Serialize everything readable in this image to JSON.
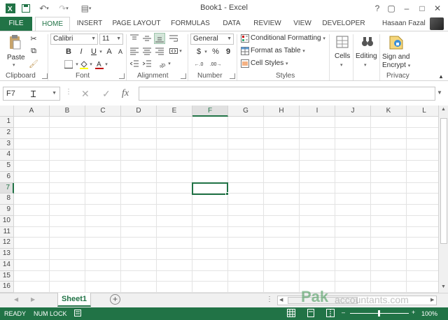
{
  "titlebar": {
    "title": "Book1 - Excel",
    "help": "?",
    "restore": "▢",
    "minimize": "–",
    "maximize": "□",
    "close": "✕"
  },
  "tabs": [
    "FILE",
    "HOME",
    "INSERT",
    "PAGE LAYOUT",
    "FORMULAS",
    "DATA",
    "REVIEW",
    "VIEW",
    "DEVELOPER"
  ],
  "user": "Hasaan Fazal",
  "ribbon": {
    "clipboard": {
      "paste": "Paste",
      "label": "Clipboard"
    },
    "font": {
      "family": "Calibri",
      "size": "11",
      "bold": "B",
      "italic": "I",
      "underline": "U",
      "grow": "A",
      "shrink": "A",
      "label": "Font"
    },
    "alignment": {
      "label": "Alignment"
    },
    "number": {
      "format": "General",
      "currency": "$",
      "percent": "%",
      "comma": "9",
      "label": "Number"
    },
    "styles": {
      "conditional": "Conditional Formatting",
      "table": "Format as Table",
      "cell": "Cell Styles",
      "label": "Styles"
    },
    "cells": {
      "label": "Cells"
    },
    "editing": {
      "label": "Editing"
    },
    "privacy": {
      "sign": "Sign and",
      "encrypt": "Encrypt",
      "label": "Privacy"
    }
  },
  "formula_bar": {
    "name_box": "F7",
    "fx": "fx",
    "cancel": "✕",
    "enter": "✓",
    "value": ""
  },
  "grid": {
    "columns": [
      "A",
      "B",
      "C",
      "D",
      "E",
      "F",
      "G",
      "H",
      "I",
      "J",
      "K",
      "L"
    ],
    "rows": [
      "1",
      "2",
      "3",
      "4",
      "5",
      "6",
      "7",
      "8",
      "9",
      "10",
      "11",
      "12",
      "13",
      "14",
      "15",
      "16"
    ],
    "active_column": "F",
    "active_row": "7"
  },
  "sheet_tabs": {
    "active": "Sheet1",
    "add": "+",
    "more": "⋮"
  },
  "status_bar": {
    "ready": "READY",
    "numlock": "NUM LOCK",
    "zoom": "100%",
    "zoom_out": "–",
    "zoom_in": "+"
  },
  "watermark": {
    "brand": "Pak",
    "suffix": "accountants.com"
  },
  "colors": {
    "accent": "#217346"
  }
}
